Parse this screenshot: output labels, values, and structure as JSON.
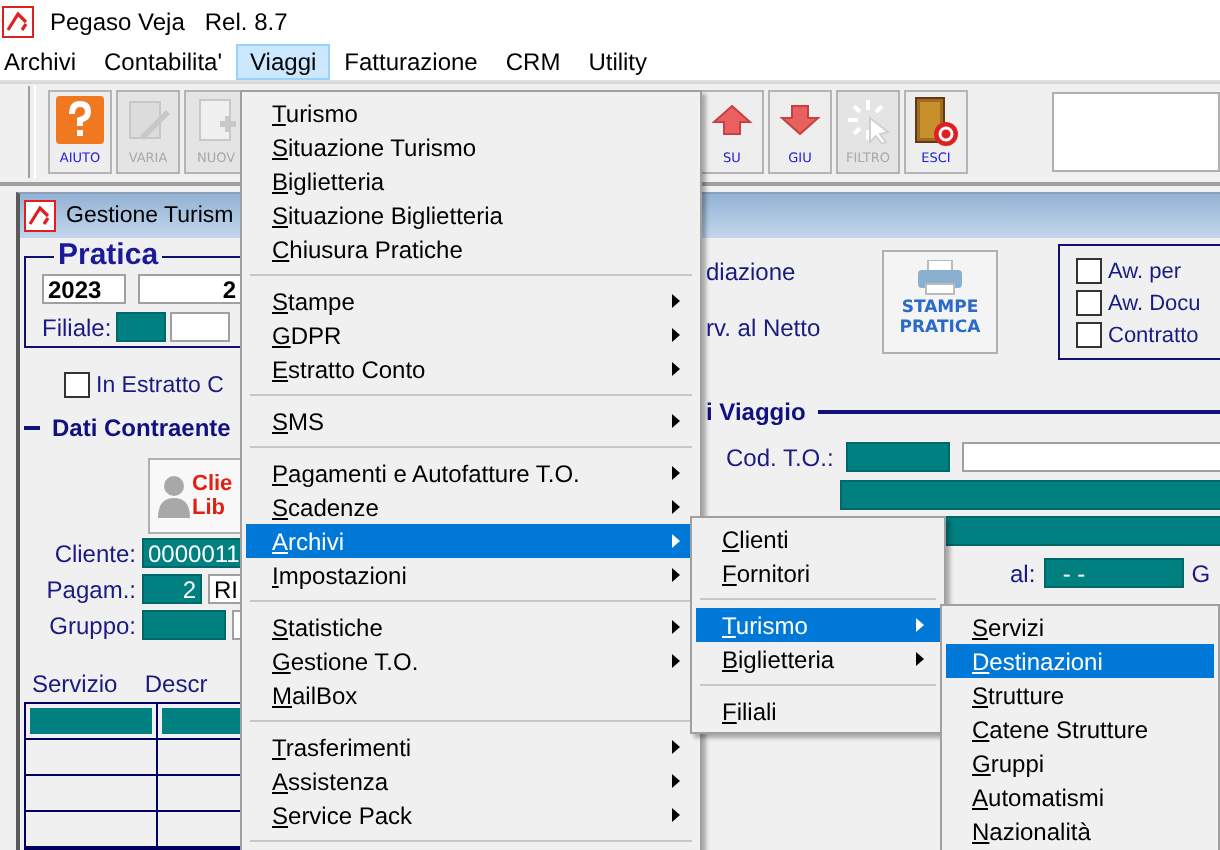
{
  "app": {
    "title": "Pegaso Veja",
    "release": "Rel. 8.7"
  },
  "menubar": [
    {
      "label": "Archivi",
      "selected": false
    },
    {
      "label": "Contabilita'",
      "selected": false
    },
    {
      "label": "Viaggi",
      "selected": true
    },
    {
      "label": "Fatturazione",
      "selected": false
    },
    {
      "label": "CRM",
      "selected": false
    },
    {
      "label": "Utility",
      "selected": false
    }
  ],
  "toolbar": {
    "left": [
      {
        "label": "AIUTO",
        "kind": "help",
        "disabled": false
      },
      {
        "label": "VARIA",
        "kind": "edit",
        "disabled": true
      },
      {
        "label": "NUOV",
        "kind": "new",
        "disabled": true
      }
    ],
    "right": [
      {
        "label": "SU",
        "kind": "up",
        "disabled": false
      },
      {
        "label": "GIU",
        "kind": "down",
        "disabled": false
      },
      {
        "label": "FILTRO",
        "kind": "filter",
        "disabled": true
      },
      {
        "label": "ESCI",
        "kind": "exit",
        "disabled": false
      }
    ]
  },
  "window": {
    "title": "Gestione Turism"
  },
  "pratica": {
    "legend": "Pratica",
    "year": "2023",
    "number": "2",
    "branch_label": "Filiale:"
  },
  "estratto_conto": {
    "label": "In Estratto C",
    "checked": false
  },
  "contraente": {
    "legend": "Dati Contraente",
    "client_button": [
      "Clie",
      "Lib"
    ],
    "fields": [
      {
        "label": "Cliente:",
        "value": "0000011"
      },
      {
        "label": "Pagam.:",
        "value": "2",
        "extra": "RI"
      },
      {
        "label": "Gruppo:"
      }
    ]
  },
  "grid": {
    "columns": [
      "Servizio",
      "Descr"
    ]
  },
  "options": {
    "texts": [
      "diazione",
      "rv. al Netto"
    ],
    "print_button": "STAMPE PRATICA"
  },
  "print_options": {
    "checkboxes": [
      {
        "label": "Aw. per",
        "checked": false
      },
      {
        "label": "Aw. Docu",
        "checked": false
      },
      {
        "label": "Contratto",
        "checked": false
      }
    ]
  },
  "viaggio": {
    "legend": "i Viaggio",
    "cod_to_label": "Cod. T.O.:",
    "date_to_label": "al:",
    "date_to_value": "- -",
    "trailing_label": "G"
  },
  "menus": [
    [
      {
        "kind": "item",
        "label": "Turismo",
        "submenu": false,
        "selected": false
      },
      {
        "kind": "item",
        "label": "Situazione Turismo",
        "submenu": false,
        "selected": false
      },
      {
        "kind": "item",
        "label": "Biglietteria",
        "submenu": false,
        "selected": false
      },
      {
        "kind": "item",
        "label": "Situazione Biglietteria",
        "submenu": false,
        "selected": false
      },
      {
        "kind": "item",
        "label": "Chiusura Pratiche",
        "submenu": false,
        "selected": false
      },
      {
        "kind": "separator"
      },
      {
        "kind": "item",
        "label": "Stampe",
        "submenu": true,
        "selected": false
      },
      {
        "kind": "item",
        "label": "GDPR",
        "submenu": true,
        "selected": false
      },
      {
        "kind": "item",
        "label": "Estratto Conto",
        "submenu": true,
        "selected": false
      },
      {
        "kind": "separator"
      },
      {
        "kind": "item",
        "label": "SMS",
        "submenu": true,
        "selected": false
      },
      {
        "kind": "separator"
      },
      {
        "kind": "item",
        "label": "Pagamenti e Autofatture T.O.",
        "submenu": true,
        "selected": false
      },
      {
        "kind": "item",
        "label": "Scadenze",
        "submenu": true,
        "selected": false
      },
      {
        "kind": "item",
        "label": "Archivi",
        "submenu": true,
        "selected": true
      },
      {
        "kind": "item",
        "label": "Impostazioni",
        "submenu": true,
        "selected": false
      },
      {
        "kind": "separator"
      },
      {
        "kind": "item",
        "label": "Statistiche",
        "submenu": true,
        "selected": false
      },
      {
        "kind": "item",
        "label": "Gestione T.O.",
        "submenu": true,
        "selected": false
      },
      {
        "kind": "item",
        "label": "MailBox",
        "submenu": false,
        "selected": false
      },
      {
        "kind": "separator"
      },
      {
        "kind": "item",
        "label": "Trasferimenti",
        "submenu": true,
        "selected": false
      },
      {
        "kind": "item",
        "label": "Assistenza",
        "submenu": true,
        "selected": false
      },
      {
        "kind": "item",
        "label": "Service Pack",
        "submenu": true,
        "selected": false
      },
      {
        "kind": "separator"
      }
    ],
    [
      {
        "kind": "item",
        "label": "Clienti",
        "submenu": false,
        "selected": false
      },
      {
        "kind": "item",
        "label": "Fornitori",
        "submenu": false,
        "selected": false
      },
      {
        "kind": "separator"
      },
      {
        "kind": "item",
        "label": "Turismo",
        "submenu": true,
        "selected": true
      },
      {
        "kind": "item",
        "label": "Biglietteria",
        "submenu": true,
        "selected": false
      },
      {
        "kind": "separator"
      },
      {
        "kind": "item",
        "label": "Filiali",
        "submenu": false,
        "selected": false
      }
    ],
    [
      {
        "kind": "item",
        "label": "Servizi",
        "submenu": false,
        "selected": false
      },
      {
        "kind": "item",
        "label": "Destinazioni",
        "submenu": false,
        "selected": true
      },
      {
        "kind": "item",
        "label": "Strutture",
        "submenu": false,
        "selected": false
      },
      {
        "kind": "item",
        "label": "Catene Strutture",
        "submenu": false,
        "selected": false
      },
      {
        "kind": "item",
        "label": "Gruppi",
        "submenu": false,
        "selected": false
      },
      {
        "kind": "item",
        "label": "Automatismi",
        "submenu": false,
        "selected": false
      },
      {
        "kind": "item",
        "label": "Nazionalità",
        "submenu": false,
        "selected": false
      }
    ]
  ]
}
